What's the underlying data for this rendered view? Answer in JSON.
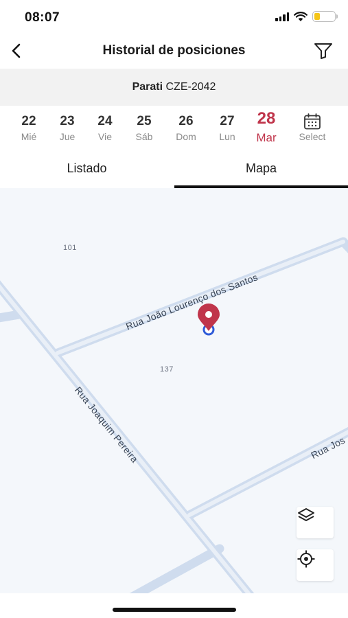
{
  "status_bar": {
    "time": "08:07",
    "icons": [
      "signal-icon",
      "wifi-icon",
      "battery-icon"
    ],
    "battery_color": "#f5c518"
  },
  "header": {
    "title": "Historial de posiciones",
    "back_icon": "chevron-left-icon",
    "filter_icon": "filter-icon"
  },
  "vehicle": {
    "name": "Parati",
    "plate": "CZE-2042"
  },
  "dates": [
    {
      "num": "22",
      "day": "Mié"
    },
    {
      "num": "23",
      "day": "Jue"
    },
    {
      "num": "24",
      "day": "Vie"
    },
    {
      "num": "25",
      "day": "Sáb"
    },
    {
      "num": "26",
      "day": "Dom"
    },
    {
      "num": "27",
      "day": "Lun"
    },
    {
      "num": "28",
      "day": "Mar",
      "selected": true
    }
  ],
  "select_label": "Select",
  "accent_color": "#c0354b",
  "tabs": [
    {
      "label": "Listado",
      "active": false
    },
    {
      "label": "Mapa",
      "active": true
    }
  ],
  "map": {
    "block_numbers": [
      "101",
      "137"
    ],
    "streets": [
      "Rua João Lourenço dos Santos",
      "Rua Joaquim Pereira",
      "Rua Jos"
    ],
    "pin_color": "#c0354b",
    "marker_ring_color": "#2f5bd8",
    "buttons": {
      "layers_icon": "layers-icon",
      "locate_icon": "locate-icon"
    }
  }
}
